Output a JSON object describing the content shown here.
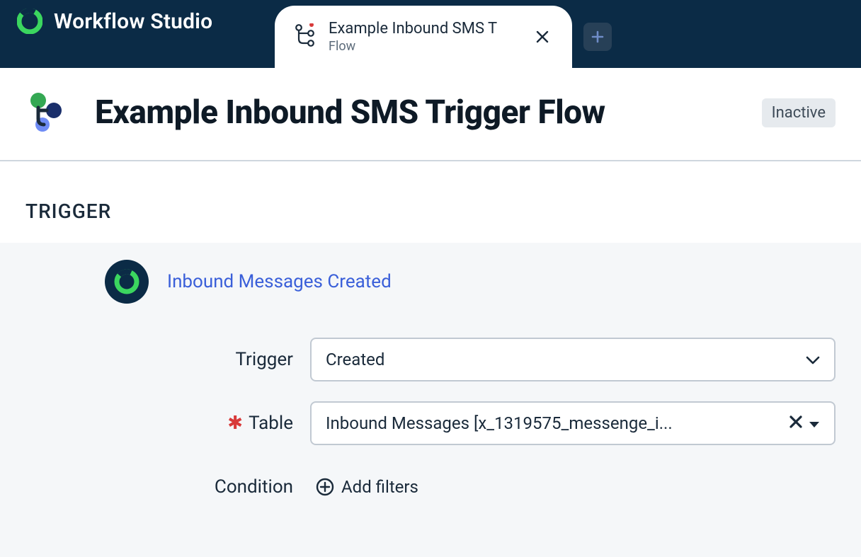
{
  "brand": {
    "name": "Workflow Studio"
  },
  "tab": {
    "title": "Example Inbound SMS T",
    "subtitle": "Flow"
  },
  "page": {
    "title": "Example Inbound SMS Trigger Flow",
    "status": "Inactive"
  },
  "section": {
    "trigger_label": "TRIGGER",
    "trigger_name": "Inbound Messages Created"
  },
  "form": {
    "trigger_label": "Trigger",
    "trigger_value": "Created",
    "table_label": "Table",
    "table_value": "Inbound Messages [x_1319575_messenge_i...",
    "condition_label": "Condition",
    "add_filters_label": "Add filters"
  }
}
